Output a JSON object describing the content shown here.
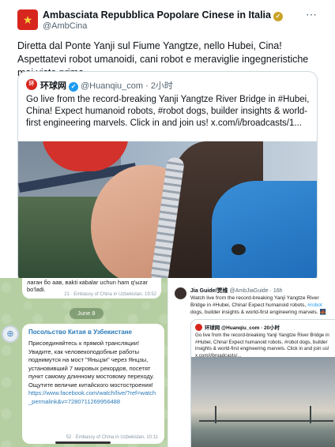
{
  "main_tweet": {
    "author_name": "Ambasciata Repubblica Popolare Cinese in Italia",
    "author_handle": "@AmbCina",
    "avatar_symbol": "★",
    "more_icon": "⋯",
    "text": "Diretta dal Ponte Yanji sul Fiume Yangtze, nello Hubei, Cina! Aspettatevi robot umanoidi, cani robot e meraviglie ingegneristiche mai viste prima.",
    "quote": {
      "avatar_text": "环",
      "author_name": "环球网",
      "handle_time": "@Huanqiu_com · 2小时",
      "text": "Go live from the record-breaking Yanji Yangtze River Bridge in #Hubei, China! Expect humanoid robots, #robot dogs, builder insights & world-first engineering marvels. Click in and join us! x.com/i/broadcasts/1..."
    }
  },
  "telegram": {
    "top_message": "лаган бо аав, ваkti кabalar uchun hаm q'ыzar bo'ladi.",
    "top_meta": "21 · Embassy of China in Uzbekistan, 19:52",
    "date_badge": "June 8",
    "avatar_symbol": "⊕",
    "sender": "Посольство Китая в Узбекистане",
    "body": "Присоединяйтесь к прямой трансляции! Увидите, как человекоподобные работы поднимутся на мост \"Яньцзи\" через Янцзы, установивший 7 мировых рекордов, посетят пункт самому длинному мостовому переходу. Ощутите величие китайского мостостроения!",
    "link": "https://www.facebook.com/watch/live/?ref=watch_permalink&v=7280711269956488",
    "meta": "52 · Embassy of China in Uzbekistan, 10:11"
  },
  "repost": {
    "author_name": "Jia Guide/贾维",
    "author_handle": "@AmbJiaGuide · 16h",
    "text_before_tag": "Watch live from the record-breaking Yanji Yangtze River Bridge in #Hubei, China! Expect humanoid robots,",
    "tag": "#robot",
    "text_after_tag": "dogs, builder insights & world-first engineering marvels. 🌉",
    "quote": {
      "author_name": "环球网 @Huanqiu_com · 20小时",
      "text": "Go live from the record-breaking Yanji Yangtze River Bridge in #Hubei, China! Expect humanoid robots, #robot dogs, builder insights & world-first engineering marvels. Click in and join us! x.com/i/broadcasts/..."
    }
  }
}
